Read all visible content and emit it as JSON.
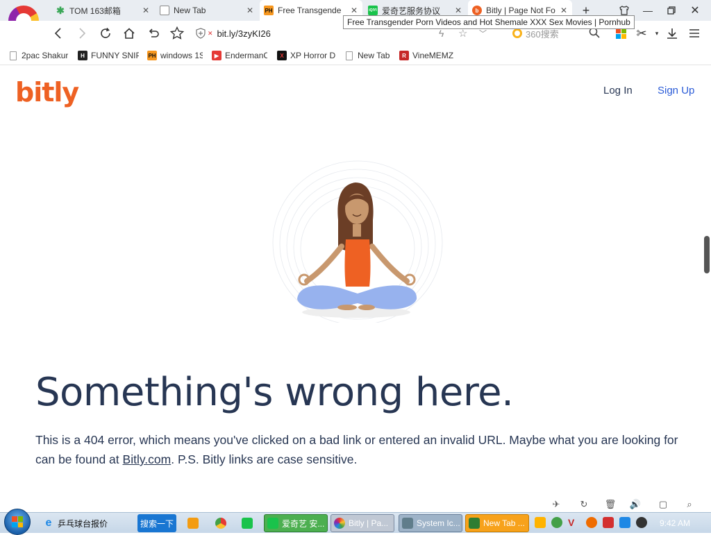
{
  "tabs": [
    {
      "label": "TOM 163邮箱",
      "icon": "tom-mail-favicon-icon",
      "color": "#3aa757",
      "active": false
    },
    {
      "label": "New Tab",
      "icon": "new-tab-favicon-icon",
      "color": "#888888",
      "active": false
    },
    {
      "label": "Free Transgende",
      "icon": "ph-favicon-icon",
      "color": "#f7971e",
      "active": true,
      "glyph": "PH"
    },
    {
      "label": "爱奇艺服务协议",
      "icon": "iqiyi-favicon-icon",
      "color": "#19c34b",
      "active": false,
      "glyph": "iQIYI"
    },
    {
      "label": "Bitly | Page Not Fo",
      "icon": "bitly-favicon-icon",
      "color": "#ee6123",
      "active": false,
      "glyph": "b"
    }
  ],
  "tooltip": "Free Transgender Porn Videos and Hot Shemale XXX Sex Movies | Pornhub",
  "toolbar": {
    "url": "bit.ly/3zyKI26",
    "search_placeholder": "360搜索"
  },
  "bookmarks": [
    {
      "label": "2pac Shakur",
      "icon": "page-icon"
    },
    {
      "label": "FUNNY SNIP",
      "icon": "hub-icon",
      "glyph": "H",
      "color": "#222222"
    },
    {
      "label": "windows 1S",
      "icon": "ph-icon",
      "glyph": "PH",
      "color": "#f7971e"
    },
    {
      "label": "EndermanC",
      "icon": "youtube-icon",
      "glyph": "▶",
      "color": "#e53935"
    },
    {
      "label": "XP Horror D",
      "icon": "x-icon",
      "glyph": "X",
      "color": "#b00000"
    },
    {
      "label": "New Tab",
      "icon": "page-icon"
    },
    {
      "label": "VineMEMZ",
      "icon": "r-icon",
      "glyph": "R",
      "color": "#c62828"
    }
  ],
  "page": {
    "logo": "bitly",
    "login": "Log In",
    "signup": "Sign Up",
    "headline": "Something's wrong here.",
    "body_before": "This is a 404 error, which means you've clicked on a bad link or entered an invalid URL. Maybe what you are looking for can be found at ",
    "body_link": "Bitly.com",
    "body_after": ". P.S. Bitly links are case sensitive."
  },
  "taskbar": {
    "items": [
      {
        "label": "乒乓球台报价",
        "icon": "ie-icon",
        "color": "#1e88e5"
      },
      {
        "label": "搜索一下",
        "icon": "search-button",
        "color": "#1976d2"
      },
      {
        "label": "爱奇艺 安...",
        "icon": "iqiyi-icon",
        "color": "#19c34b"
      },
      {
        "label": "Bitly | Pa...",
        "icon": "360-browser-icon",
        "color": "#e53935"
      },
      {
        "label": "System Ic...",
        "icon": "system-icon",
        "color": "#607d8b"
      },
      {
        "label": "New Tab ...",
        "icon": "shield-icon",
        "color": "#f7a21b"
      }
    ],
    "clock": "9:42 AM"
  }
}
